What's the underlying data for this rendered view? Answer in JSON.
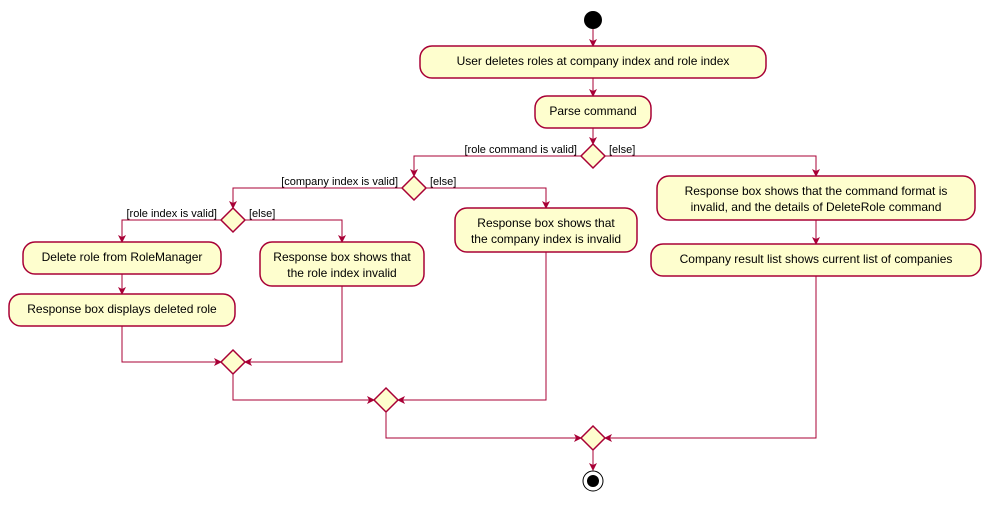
{
  "chart_data": {
    "type": "activity-diagram",
    "title": "",
    "nodes": {
      "start": {
        "kind": "initial"
      },
      "n1": {
        "kind": "action",
        "text": "User deletes roles at company index and role index"
      },
      "n2": {
        "kind": "action",
        "text": "Parse command"
      },
      "d1": {
        "kind": "decision"
      },
      "d2": {
        "kind": "decision"
      },
      "d3": {
        "kind": "decision"
      },
      "n3": {
        "kind": "action",
        "text": "Delete role from RoleManager"
      },
      "n4": {
        "kind": "action",
        "text": "Response box displays deleted role"
      },
      "n5": {
        "kind": "action",
        "text_lines": [
          "Response box shows that",
          "the role index invalid"
        ]
      },
      "n6": {
        "kind": "action",
        "text_lines": [
          "Response box shows that",
          "the company index is invalid"
        ]
      },
      "n7": {
        "kind": "action",
        "text_lines": [
          "Response box shows that the command format is",
          "invalid, and the details of DeleteRole command"
        ]
      },
      "n8": {
        "kind": "action",
        "text": "Company result list shows current list of companies"
      },
      "m3": {
        "kind": "merge"
      },
      "m2": {
        "kind": "merge"
      },
      "m1": {
        "kind": "merge"
      },
      "end": {
        "kind": "final"
      }
    },
    "edges": [
      {
        "from": "start",
        "to": "n1"
      },
      {
        "from": "n1",
        "to": "n2"
      },
      {
        "from": "n2",
        "to": "d1"
      },
      {
        "from": "d1",
        "to": "d2",
        "guard": "[role command is valid]",
        "side": "left"
      },
      {
        "from": "d1",
        "to": "n7",
        "guard": "[else]",
        "side": "right"
      },
      {
        "from": "d2",
        "to": "d3",
        "guard": "[company index is valid]",
        "side": "left"
      },
      {
        "from": "d2",
        "to": "n6",
        "guard": "[else]",
        "side": "right"
      },
      {
        "from": "d3",
        "to": "n3",
        "guard": "[role index is valid]",
        "side": "left"
      },
      {
        "from": "d3",
        "to": "n5",
        "guard": "[else]",
        "side": "right"
      },
      {
        "from": "n3",
        "to": "n4"
      },
      {
        "from": "n4",
        "to": "m3"
      },
      {
        "from": "n5",
        "to": "m3"
      },
      {
        "from": "m3",
        "to": "m2"
      },
      {
        "from": "n6",
        "to": "m2"
      },
      {
        "from": "m2",
        "to": "m1"
      },
      {
        "from": "n7",
        "to": "n8"
      },
      {
        "from": "n8",
        "to": "m1"
      },
      {
        "from": "m1",
        "to": "end"
      }
    ],
    "guards": {
      "g_d1_left": "[role command is valid]",
      "g_d1_right": "[else]",
      "g_d2_left": "[company index is valid]",
      "g_d2_right": "[else]",
      "g_d3_left": "[role index is valid]",
      "g_d3_right": "[else]"
    },
    "node_text": {
      "n1": "User deletes roles at company index and role index",
      "n2": "Parse command",
      "n3": "Delete role from RoleManager",
      "n4": "Response box displays deleted role",
      "n5a": "Response box shows that",
      "n5b": "the role index invalid",
      "n6a": "Response box shows that",
      "n6b": "the company index is invalid",
      "n7a": "Response box shows that the command format is",
      "n7b": "invalid, and the details of DeleteRole command",
      "n8": "Company result list shows current list of companies"
    }
  }
}
